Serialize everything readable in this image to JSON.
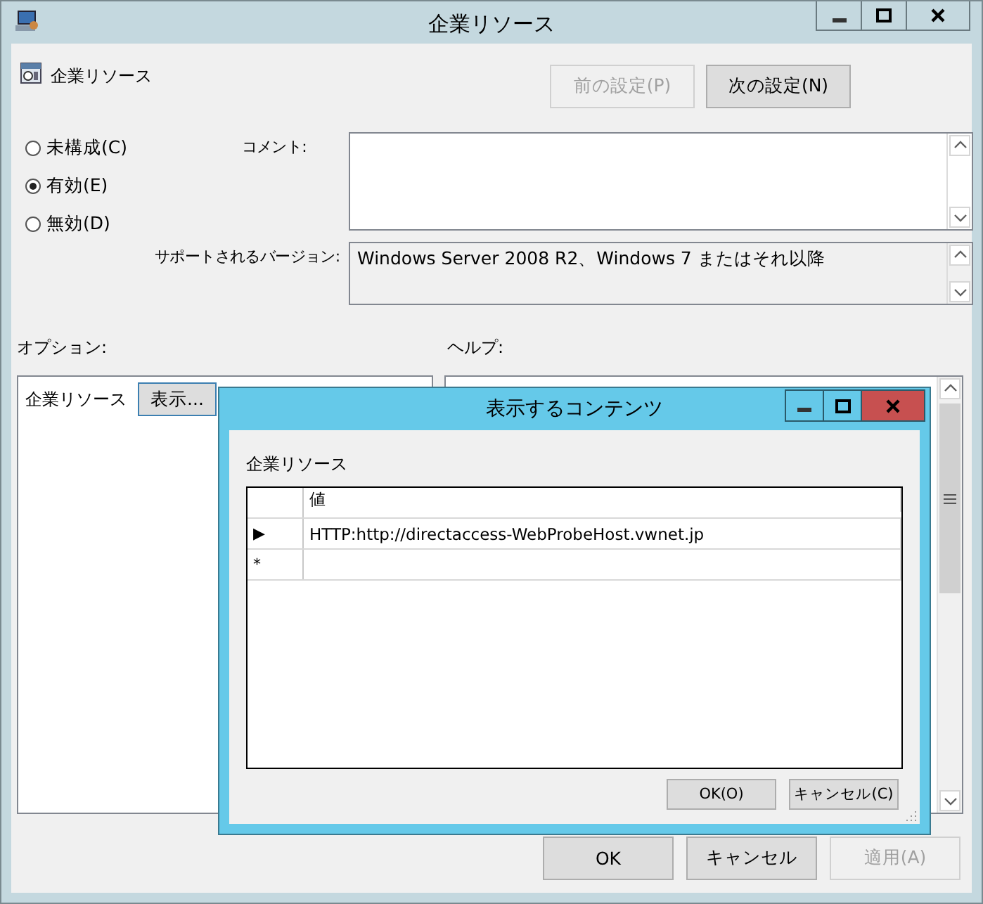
{
  "window": {
    "title": "企業リソース"
  },
  "header": {
    "title": "企業リソース"
  },
  "nav_buttons": [
    {
      "label": "前の設定(P)",
      "disabled": true
    },
    {
      "label": "次の設定(N)",
      "disabled": false
    }
  ],
  "radios": [
    {
      "label": "未構成(C)",
      "selected": false
    },
    {
      "label": "有効(E)",
      "selected": true
    },
    {
      "label": "無効(D)",
      "selected": false
    }
  ],
  "comment": {
    "label": "コメント:"
  },
  "supported": {
    "label": "サポートされるバージョン:",
    "value": "Windows Server 2008 R2、Windows 7 またはそれ以降"
  },
  "options": {
    "label": "オプション:",
    "items": [
      {
        "label": "企業リソース",
        "button": "表示..."
      }
    ]
  },
  "help": {
    "label": "ヘルプ:"
  },
  "buttons": [
    {
      "label": "OK",
      "disabled": false
    },
    {
      "label": "キャンセル",
      "disabled": false
    },
    {
      "label": "適用(A)",
      "disabled": true
    }
  ],
  "dialog": {
    "title": "表示するコンテンツ",
    "label": "企業リソース",
    "column": "値",
    "rows": [
      {
        "marker": "▶",
        "value": "HTTP:http://directaccess-WebProbeHost.vwnet.jp"
      },
      {
        "marker": "*",
        "value": ""
      }
    ],
    "buttons": [
      {
        "label": "OK(O)"
      },
      {
        "label": "キャンセル(C)"
      }
    ]
  }
}
